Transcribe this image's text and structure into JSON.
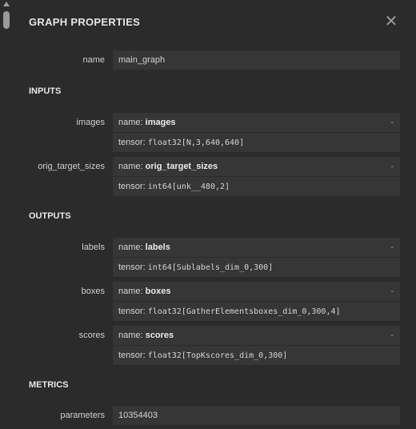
{
  "header": {
    "title": "GRAPH PROPERTIES",
    "close_icon": "close-icon"
  },
  "graph": {
    "name_label": "name",
    "name_value": "main_graph"
  },
  "inputs": {
    "section_label": "INPUTS",
    "items": [
      {
        "label": "images",
        "name_prefix": "name: ",
        "name": "images",
        "tensor_prefix": "tensor: ",
        "tensor": "float32[N,3,640,640]",
        "toggle": "-"
      },
      {
        "label": "orig_target_sizes",
        "name_prefix": "name: ",
        "name": "orig_target_sizes",
        "tensor_prefix": "tensor: ",
        "tensor": "int64[unk__480,2]",
        "toggle": "-"
      }
    ]
  },
  "outputs": {
    "section_label": "OUTPUTS",
    "items": [
      {
        "label": "labels",
        "name_prefix": "name: ",
        "name": "labels",
        "tensor_prefix": "tensor: ",
        "tensor": "int64[Sublabels_dim_0,300]",
        "toggle": "-"
      },
      {
        "label": "boxes",
        "name_prefix": "name: ",
        "name": "boxes",
        "tensor_prefix": "tensor: ",
        "tensor": "float32[GatherElementsboxes_dim_0,300,4]",
        "toggle": "-"
      },
      {
        "label": "scores",
        "name_prefix": "name: ",
        "name": "scores",
        "tensor_prefix": "tensor: ",
        "tensor": "float32[TopKscores_dim_0,300]",
        "toggle": "-"
      }
    ]
  },
  "metrics": {
    "section_label": "METRICS",
    "parameters_label": "parameters",
    "parameters_value": "10354403"
  }
}
